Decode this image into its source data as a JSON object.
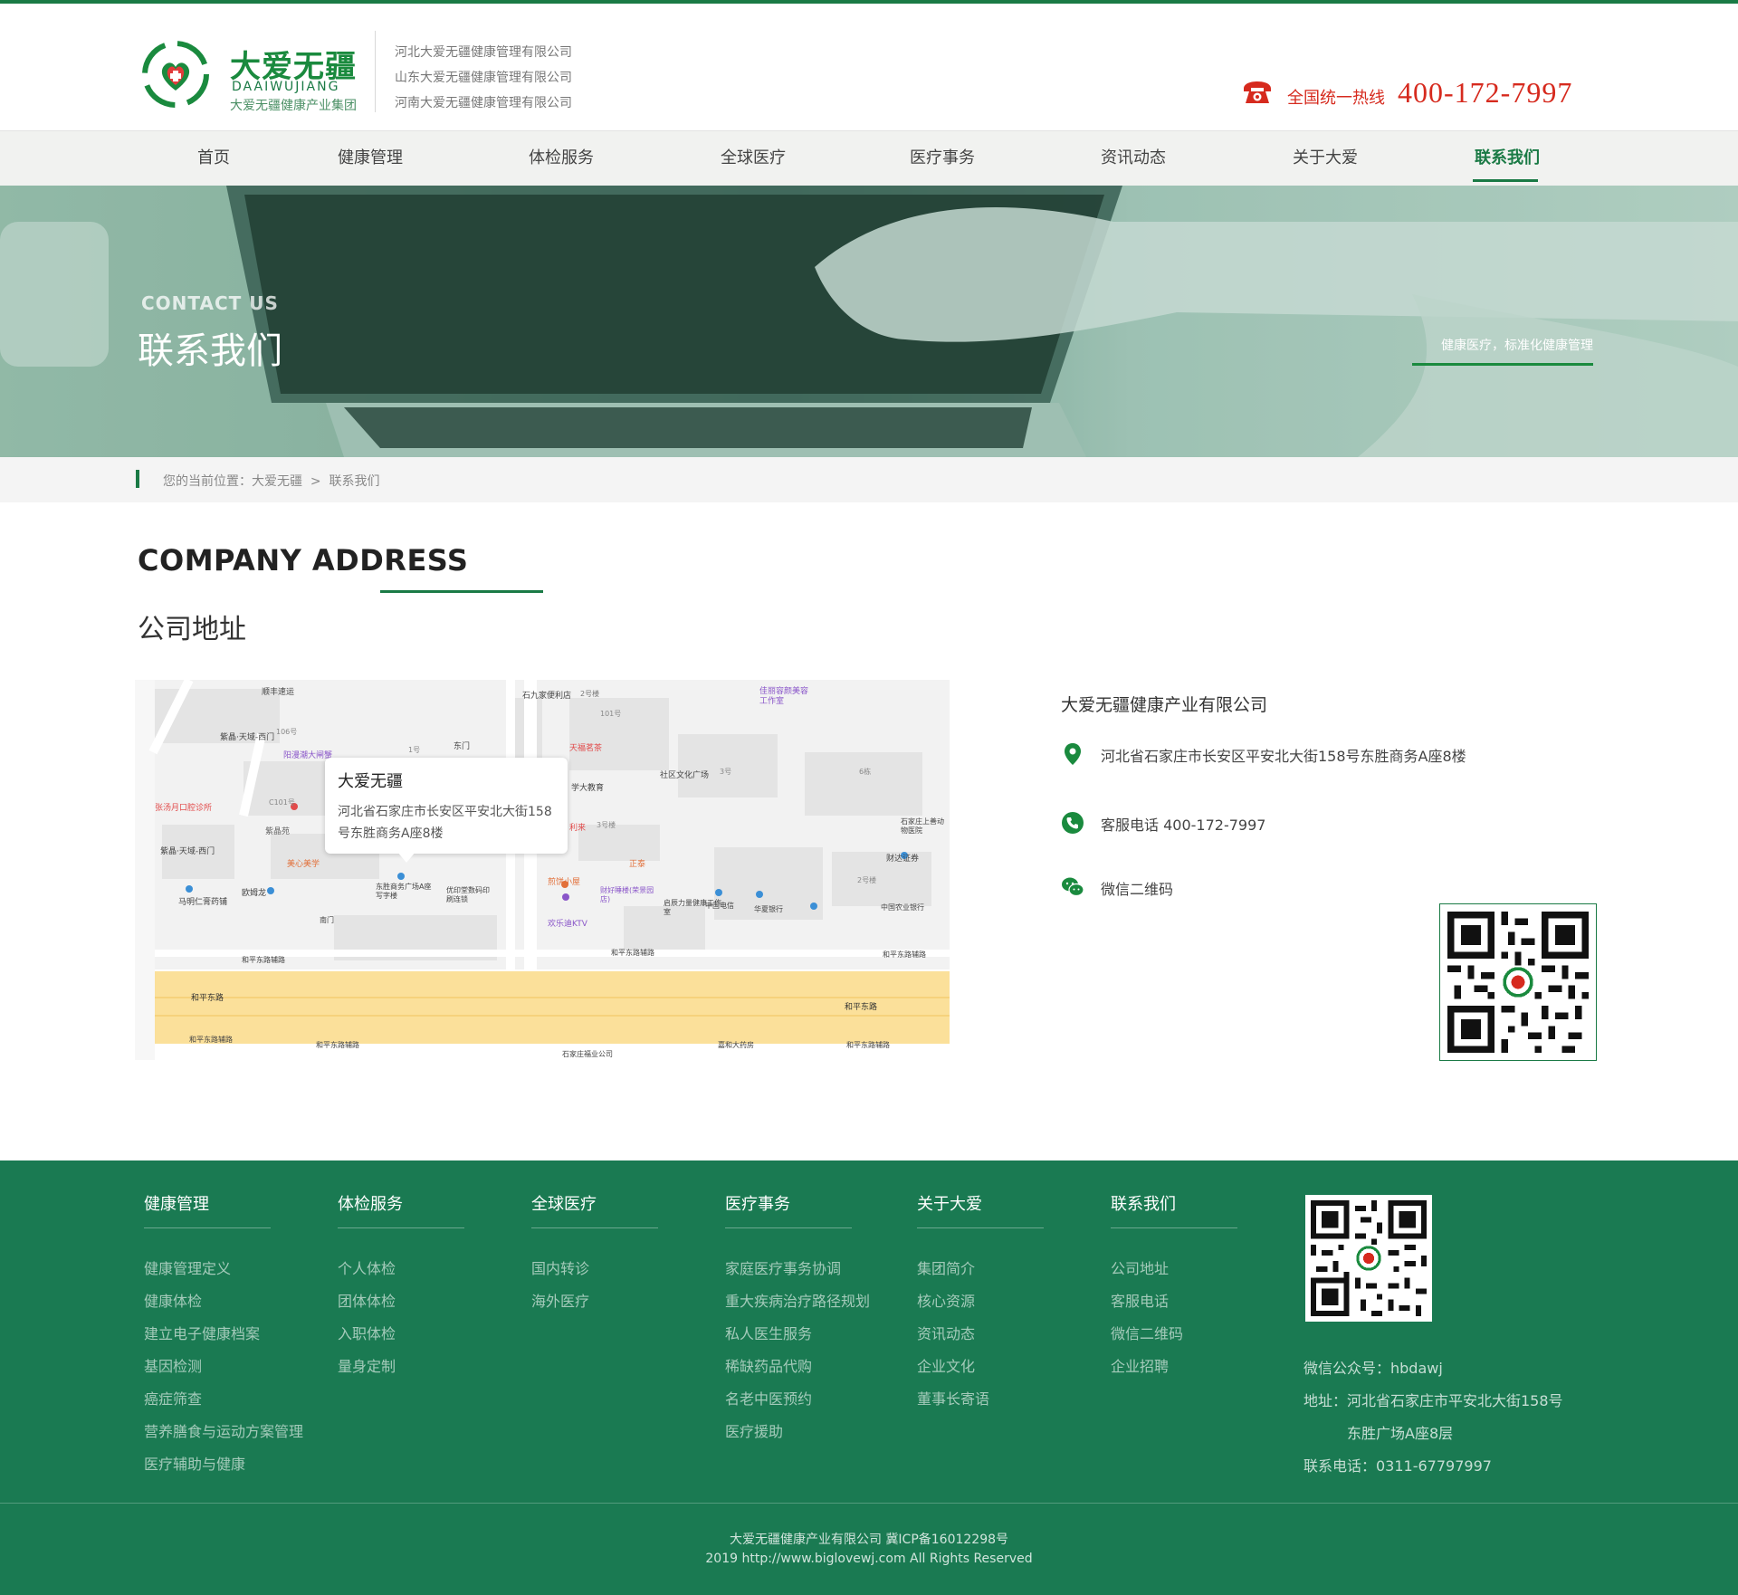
{
  "colors": {
    "brand_green": "#1a7a45",
    "footer_green": "#1a7a52",
    "hotline_red": "#d62a1e"
  },
  "header": {
    "logo": {
      "name": "大爱无疆",
      "pinyin": "DAAIWUJIANG",
      "group": "大爱无疆健康产业集团",
      "icon": "heart-hands-logo-icon"
    },
    "companies": [
      "河北大爱无疆健康管理有限公司",
      "山东大爱无疆健康管理有限公司",
      "河南大爱无疆健康管理有限公司"
    ],
    "hotline": {
      "label": "全国统一热线",
      "number": "400-172-7997",
      "icon": "telephone-icon"
    }
  },
  "nav": {
    "items": [
      "首页",
      "健康管理",
      "体检服务",
      "全球医疗",
      "医疗事务",
      "资讯动态",
      "关于大爱",
      "联系我们"
    ],
    "active": "联系我们"
  },
  "banner": {
    "en": "CONTACT US",
    "cn": "联系我们",
    "slogan": "健康医疗，标准化健康管理"
  },
  "breadcrumb": {
    "prefix": "您的当前位置：",
    "home": "大爱无疆",
    "sep": ">",
    "current": "联系我们"
  },
  "section": {
    "en": "COMPANY ADDRESS",
    "cn": "公司地址"
  },
  "map": {
    "popup_title": "大爱无疆",
    "popup_address": "河北省石家庄市长安区平安北大街158号东胜商务A座8楼",
    "labels": [
      "顺丰速运",
      "石九家便利店",
      "2号楼",
      "佳丽容颜美容工作室",
      "紫晶·天域-西门",
      "106号",
      "阳漫潮大闸蟹",
      "1号",
      "东门",
      "101号",
      "天福茗茶",
      "社区文化广场",
      "3号",
      "6栋",
      "张汤月口腔诊所",
      "C101号",
      "学大教育",
      "利来",
      "3号楼",
      "石家庄上善动物医院",
      "紫晶苑",
      "紫晶·天域-西门",
      "美心美学",
      "正泰",
      "财达证券",
      "2号楼",
      "欧姆龙",
      "东胜商务广场A座写字楼",
      "优印堂数码印刷连锁",
      "煎饼小屋",
      "财好睡楼(荣景园店)",
      "启辰力量健康工作室",
      "中国电信",
      "华夏银行",
      "中国农业银行",
      "马明仁膏药铺",
      "南门",
      "欢乐迪KTV",
      "和平东路辅路",
      "和平东路辅路",
      "和平东路辅路",
      "和平东路",
      "和平东路",
      "和平东路辅路",
      "和平东路辅路",
      "石家庄福业公司",
      "嘉和大药房",
      "和平东路辅路"
    ]
  },
  "contact": {
    "company": "大爱无疆健康产业有限公司",
    "address": "河北省石家庄市长安区平安北大街158号东胜商务A座8楼",
    "phone": "客服电话 400-172-7997",
    "wechat": "微信二维码",
    "icons": [
      "location-pin-icon",
      "phone-circle-icon",
      "wechat-icon"
    ]
  },
  "footer": {
    "columns": [
      {
        "title": "健康管理",
        "links": [
          "健康管理定义",
          "健康体检",
          "建立电子健康档案",
          "基因检测",
          "癌症筛查",
          "营养膳食与运动方案管理",
          "医疗辅助与健康"
        ]
      },
      {
        "title": "体检服务",
        "links": [
          "个人体检",
          "团体体检",
          "入职体检",
          "量身定制"
        ]
      },
      {
        "title": "全球医疗",
        "links": [
          "国内转诊",
          "海外医疗"
        ]
      },
      {
        "title": "医疗事务",
        "links": [
          "家庭医疗事务协调",
          "重大疾病治疗路径规划",
          "私人医生服务",
          "稀缺药品代购",
          "名老中医预约",
          "医疗援助"
        ]
      },
      {
        "title": "关于大爱",
        "links": [
          "集团简介",
          "核心资源",
          "资讯动态",
          "企业文化",
          "董事长寄语"
        ]
      },
      {
        "title": "联系我们",
        "links": [
          "公司地址",
          "客服电话",
          "微信二维码",
          "企业招聘"
        ]
      }
    ],
    "wechat_account": "微信公众号：hbdawj",
    "address_line1": "地址：河北省石家庄市平安北大街158号",
    "address_line2": "东胜广场A座8层",
    "tel": "联系电话：0311-67797997",
    "copyright1": "大爱无疆健康产业有限公司 冀ICP备16012298号",
    "copyright2": "2019 http://www.biglovewj.com All Rights Reserved"
  }
}
